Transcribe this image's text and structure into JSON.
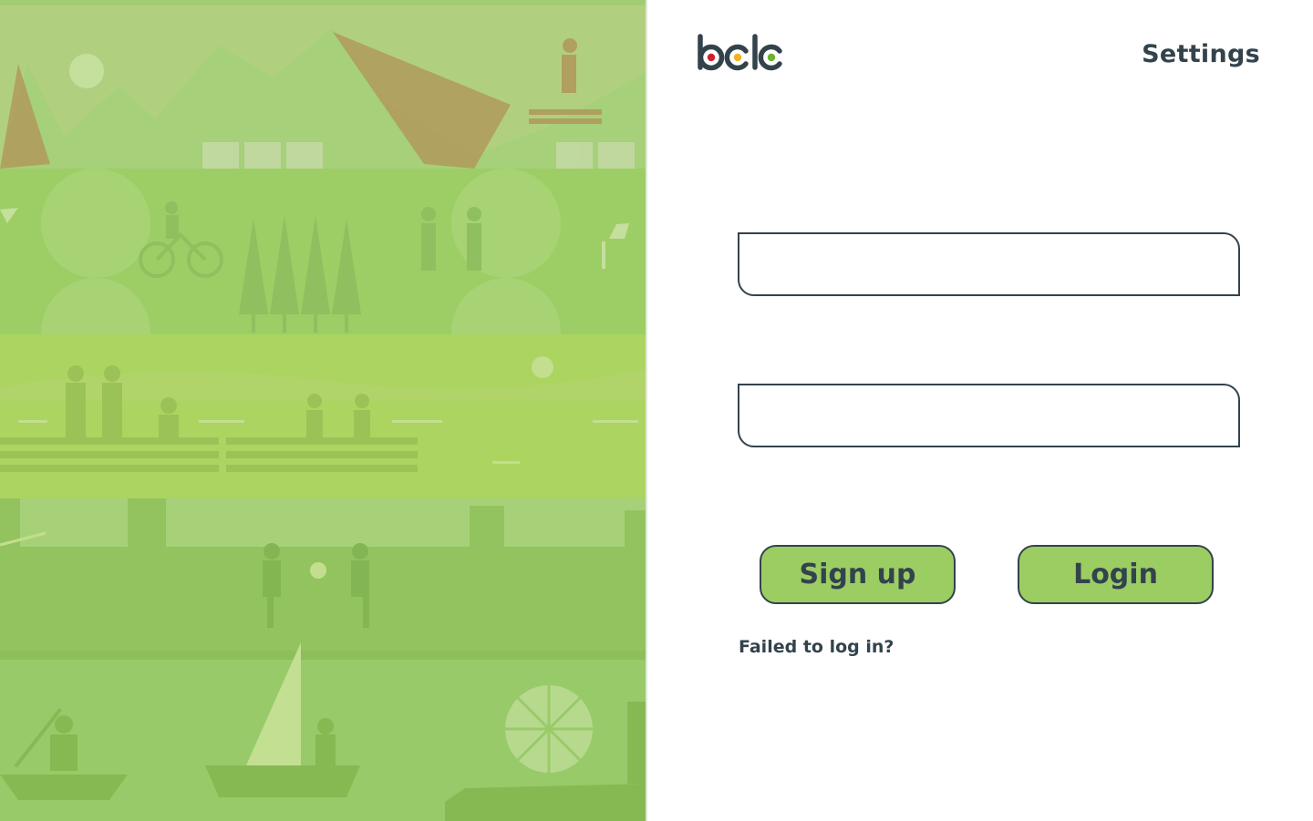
{
  "brand": {
    "logo_text": "bclc",
    "logo_dot_colors": [
      "#d0202e",
      "#f0b323",
      "#6ab42d"
    ]
  },
  "header": {
    "settings_label": "Settings"
  },
  "login_form": {
    "username": {
      "value": "",
      "placeholder": ""
    },
    "password": {
      "value": "",
      "placeholder": ""
    },
    "signup_label": "Sign up",
    "login_label": "Login",
    "failed_link": "Failed to log in?"
  },
  "colors": {
    "primary_text": "#33434c",
    "button_fill": "#9ccd63",
    "panel_green": "#a9d27a"
  }
}
